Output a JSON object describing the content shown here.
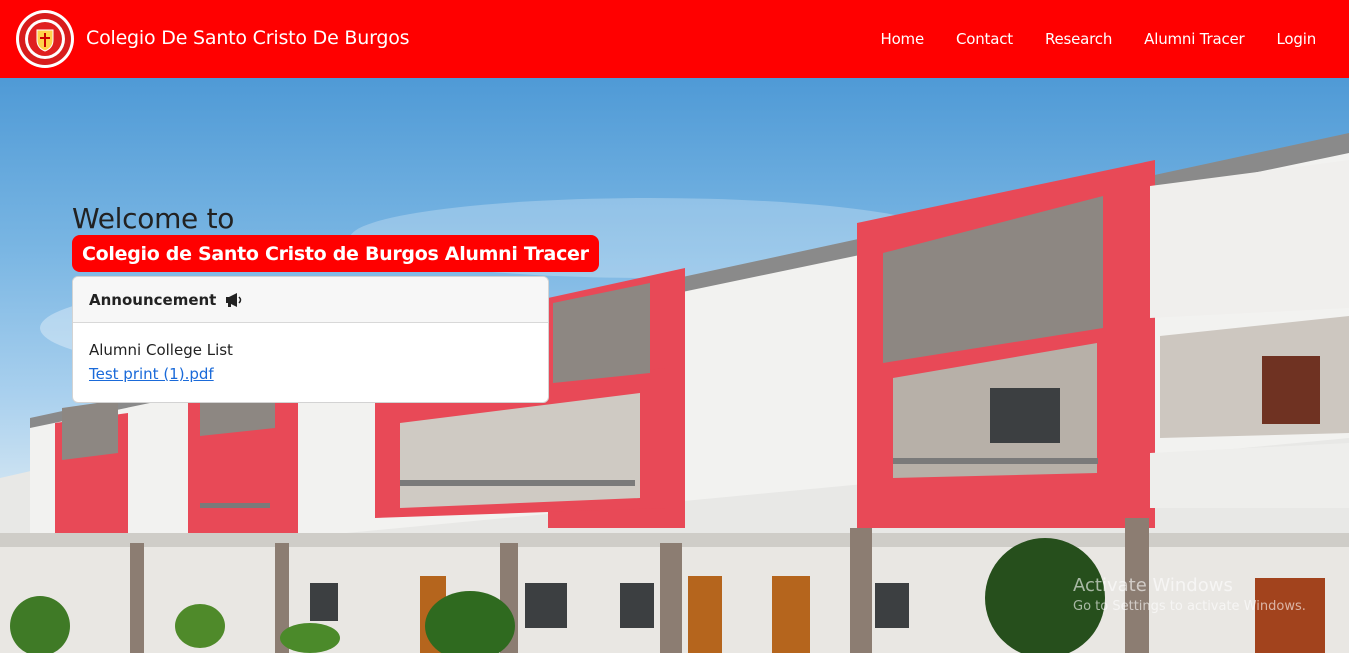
{
  "navbar": {
    "brand": "Colegio De Santo Cristo De Burgos",
    "links": [
      "Home",
      "Contact",
      "Research",
      "Alumni Tracer",
      "Login"
    ]
  },
  "hero": {
    "welcome": "Welcome to",
    "badge": "Colegio de Santo Cristo de Burgos Alumni Tracer"
  },
  "announcement": {
    "header": "Announcement",
    "icon": "megaphone-icon",
    "item_title": "Alumni College List",
    "link_text": "Test print (1).pdf"
  },
  "watermark": {
    "title": "Activate Windows",
    "subtitle": "Go to Settings to activate Windows."
  },
  "colors": {
    "brand_red": "#ff0000",
    "link_blue": "#1a6ad9"
  }
}
